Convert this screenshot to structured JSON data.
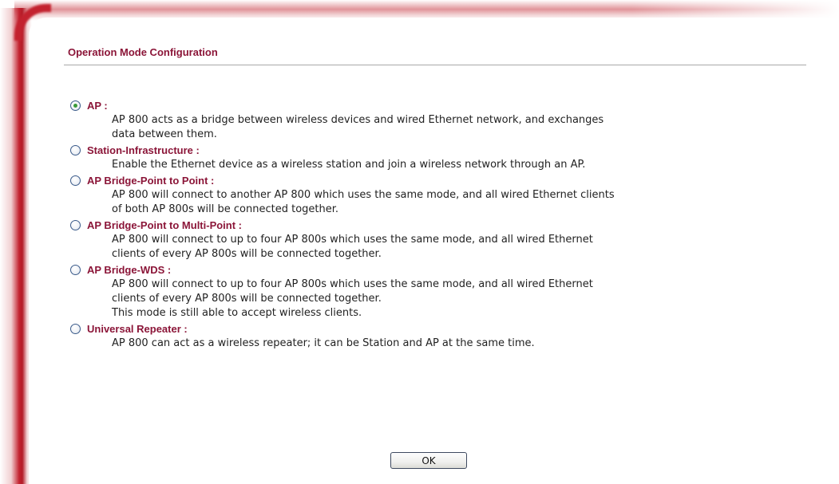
{
  "page": {
    "title": "Operation Mode Configuration"
  },
  "modes": [
    {
      "label": "AP :",
      "selected": true,
      "description": [
        "AP 800 acts as a bridge between wireless devices and wired Ethernet network, and exchanges",
        "data between them."
      ]
    },
    {
      "label": "Station-Infrastructure :",
      "selected": false,
      "description": [
        "Enable the Ethernet device as a wireless station and join a wireless network through an AP."
      ]
    },
    {
      "label": "AP Bridge-Point to Point :",
      "selected": false,
      "description": [
        "AP 800 will connect to another AP 800 which uses the same mode, and all wired Ethernet clients",
        "of both AP 800s will be connected together."
      ]
    },
    {
      "label": "AP Bridge-Point to Multi-Point :",
      "selected": false,
      "description": [
        "AP 800 will connect to up to four AP 800s which uses the same mode, and all wired Ethernet",
        "clients of every AP 800s will be connected together."
      ]
    },
    {
      "label": "AP Bridge-WDS :",
      "selected": false,
      "description": [
        "AP 800 will connect to up to four AP 800s which uses the same mode, and all wired Ethernet",
        "clients of every AP 800s will be connected together.",
        "This mode is still able to accept wireless clients."
      ]
    },
    {
      "label": "Universal Repeater :",
      "selected": false,
      "description": [
        "AP 800 can act as a wireless repeater; it can be Station and AP at the same time."
      ]
    }
  ],
  "actions": {
    "ok_label": "OK"
  },
  "colors": {
    "accent": "#8b1538",
    "frame": "#c3222f",
    "radio_checked": "#3a9a3a"
  }
}
